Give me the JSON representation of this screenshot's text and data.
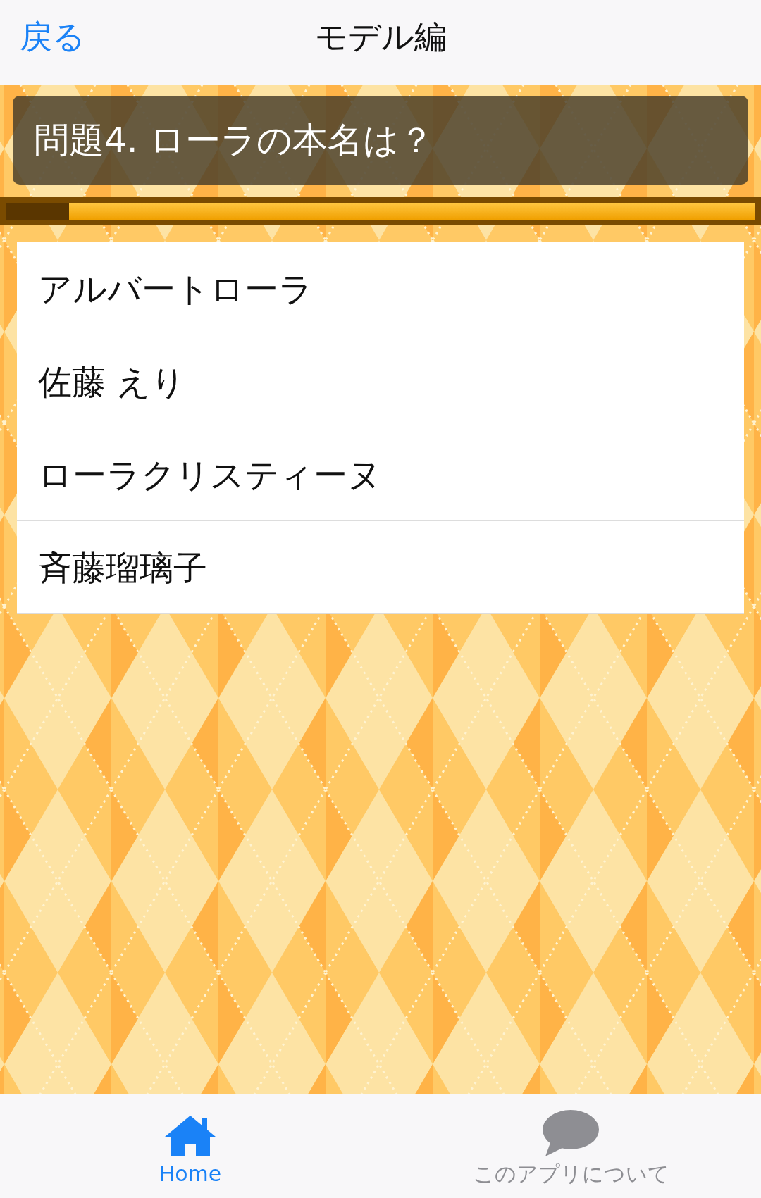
{
  "nav": {
    "back": "戻る",
    "title": "モデル編"
  },
  "question": "問題4. ローラの本名は？",
  "timer": {
    "level": 0.085
  },
  "answers": [
    {
      "label": "アルバートローラ"
    },
    {
      "label": "佐藤 えり"
    },
    {
      "label": "ローラクリスティーヌ"
    },
    {
      "label": "斉藤瑠璃子"
    }
  ],
  "tabs": [
    {
      "label": "Home",
      "selected": true
    },
    {
      "label": "このアプリについて",
      "selected": false
    }
  ]
}
